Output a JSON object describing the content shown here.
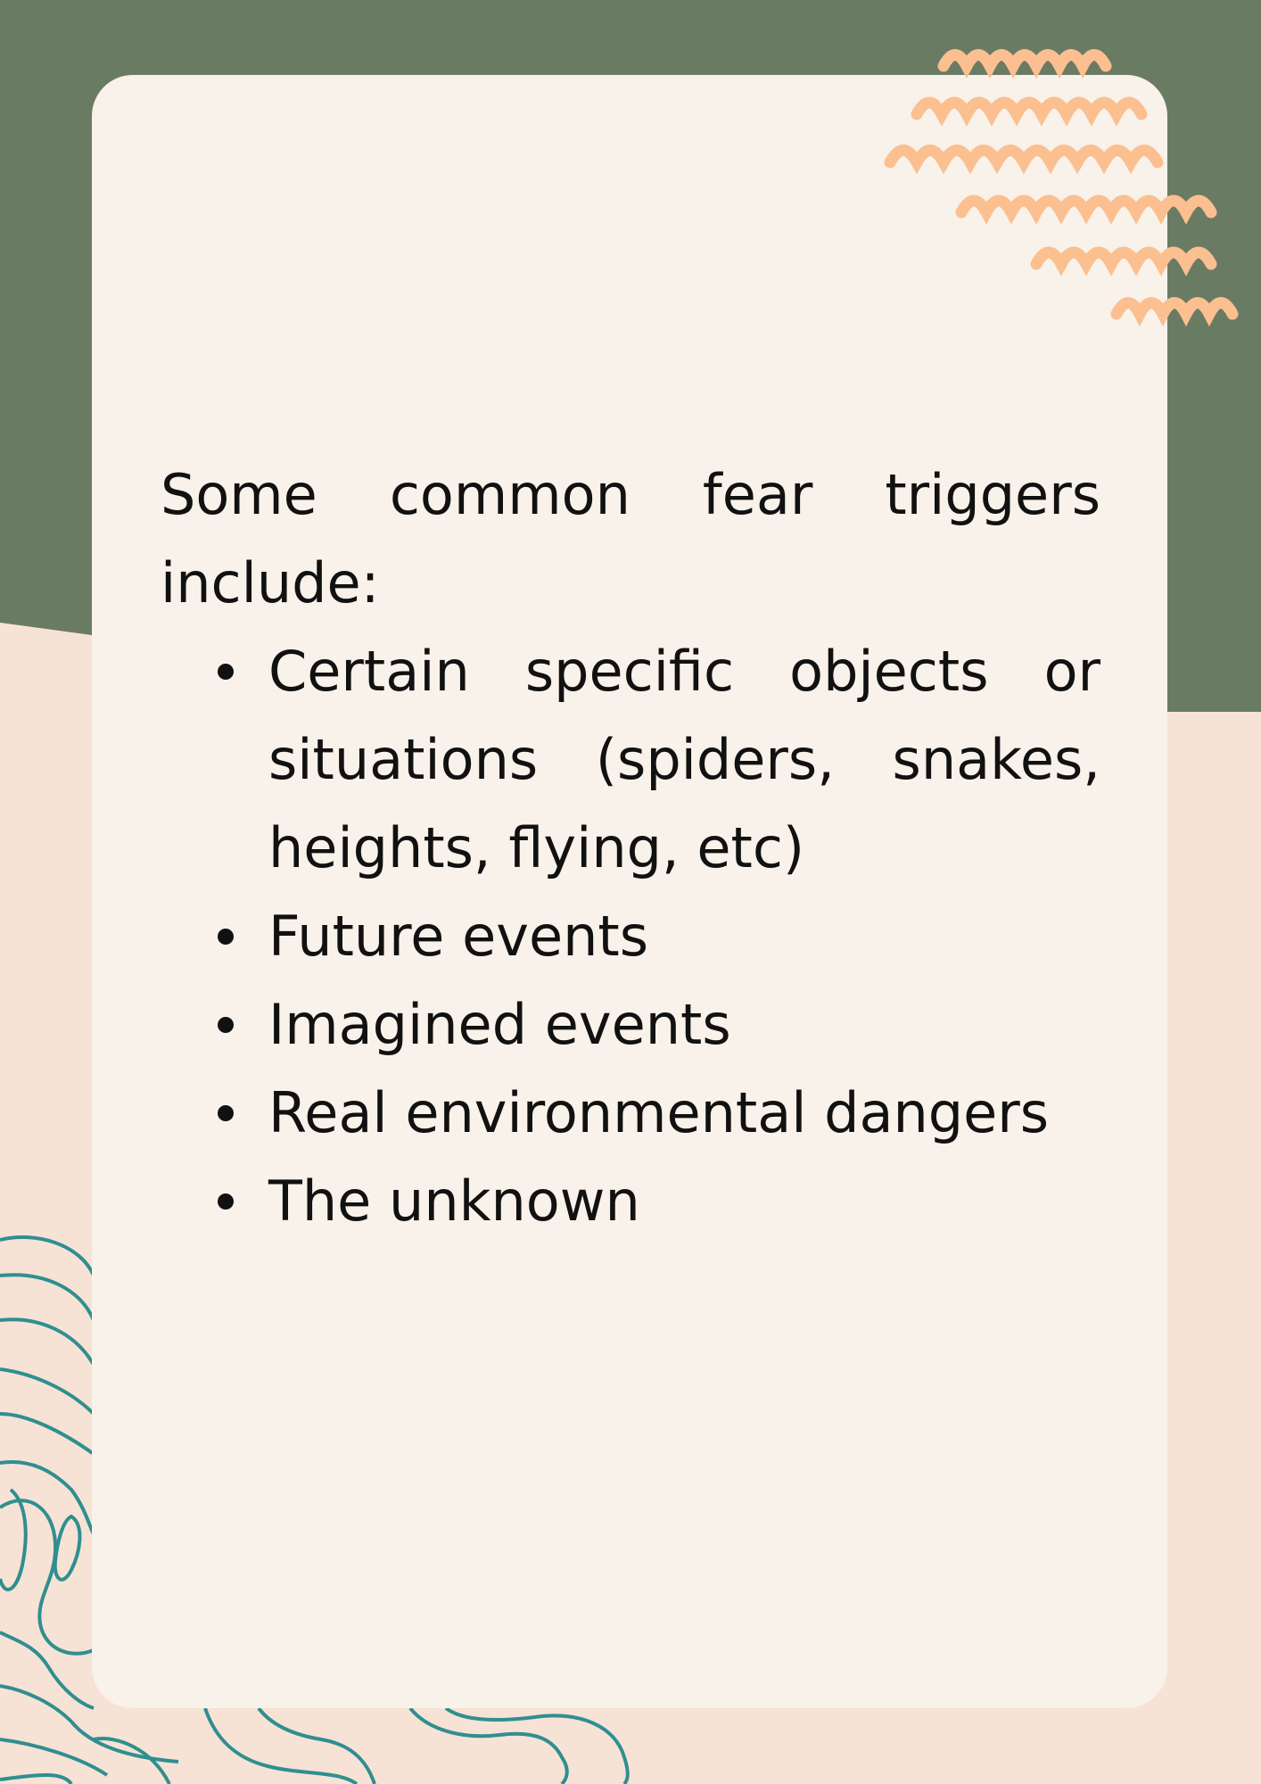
{
  "colors": {
    "green_band": "#6a7b64",
    "peach_background": "#f7e2d6",
    "card": "#f8f2ea",
    "squiggle": "#fbbf90",
    "contour_lines": "#2f8f8f",
    "text": "#111111"
  },
  "decor": {
    "top_right": "orange-squiggle-lines",
    "bottom_left": "teal-topographic-lines"
  },
  "content": {
    "intro": "Some common fear triggers include:",
    "bullets": [
      "Certain specific objects or situations (spiders, snakes, heights, flying, etc)",
      "Future events",
      "Imagined events",
      "Real environmental dangers",
      "The unknown"
    ]
  }
}
